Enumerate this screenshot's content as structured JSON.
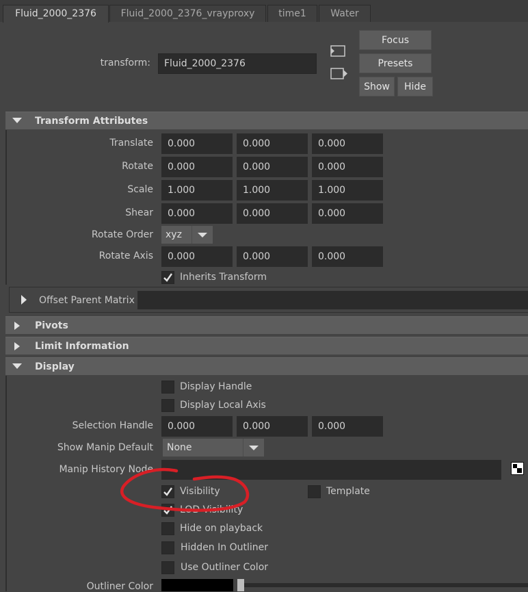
{
  "tabs": [
    {
      "label": "Fluid_2000_2376"
    },
    {
      "label": "Fluid_2000_2376_vrayproxy"
    },
    {
      "label": "time1"
    },
    {
      "label": "Water"
    }
  ],
  "header": {
    "transform_label": "transform:",
    "transform_value": "Fluid_2000_2376",
    "focus_label": "Focus",
    "presets_label": "Presets",
    "show_label": "Show",
    "hide_label": "Hide"
  },
  "transform_section": {
    "title": "Transform Attributes",
    "rows": [
      {
        "label": "Translate",
        "values": [
          "0.000",
          "0.000",
          "0.000"
        ]
      },
      {
        "label": "Rotate",
        "values": [
          "0.000",
          "0.000",
          "0.000"
        ]
      },
      {
        "label": "Scale",
        "values": [
          "1.000",
          "1.000",
          "1.000"
        ]
      },
      {
        "label": "Shear",
        "values": [
          "0.000",
          "0.000",
          "0.000"
        ]
      }
    ],
    "rotate_order_label": "Rotate Order",
    "rotate_order_value": "xyz",
    "rotate_axis": {
      "label": "Rotate Axis",
      "values": [
        "0.000",
        "0.000",
        "0.000"
      ]
    },
    "inherits_transform_label": "Inherits Transform",
    "inherits_transform_checked": true,
    "offset_parent_matrix_label": "Offset Parent Matrix"
  },
  "pivots_section": {
    "title": "Pivots"
  },
  "limit_section": {
    "title": "Limit Information"
  },
  "display_section": {
    "title": "Display",
    "display_handle_label": "Display Handle",
    "display_local_axis_label": "Display Local Axis",
    "selection_handle": {
      "label": "Selection Handle",
      "values": [
        "0.000",
        "0.000",
        "0.000"
      ]
    },
    "show_manip_default_label": "Show Manip Default",
    "show_manip_default_value": "None",
    "manip_history_node_label": "Manip History Node",
    "visibility_label": "Visibility",
    "template_label": "Template",
    "lod_visibility_label": "LOD Visibility",
    "hide_on_playback_label": "Hide on playback",
    "hidden_in_outliner_label": "Hidden In Outliner",
    "use_outliner_color_label": "Use Outliner Color",
    "outliner_color_label": "Outliner Color"
  },
  "colors": {
    "annotation": "#d81f26",
    "outliner_swatch": "#000000",
    "panel_bg": "#444444",
    "section_bg": "#5d5d5d"
  },
  "icons": [
    "expand-left-icon",
    "expand-right-icon",
    "collapse-arrow-icon",
    "expand-arrow-icon",
    "checkmark-icon",
    "dropdown-arrow-icon",
    "node-navigator-icon"
  ]
}
